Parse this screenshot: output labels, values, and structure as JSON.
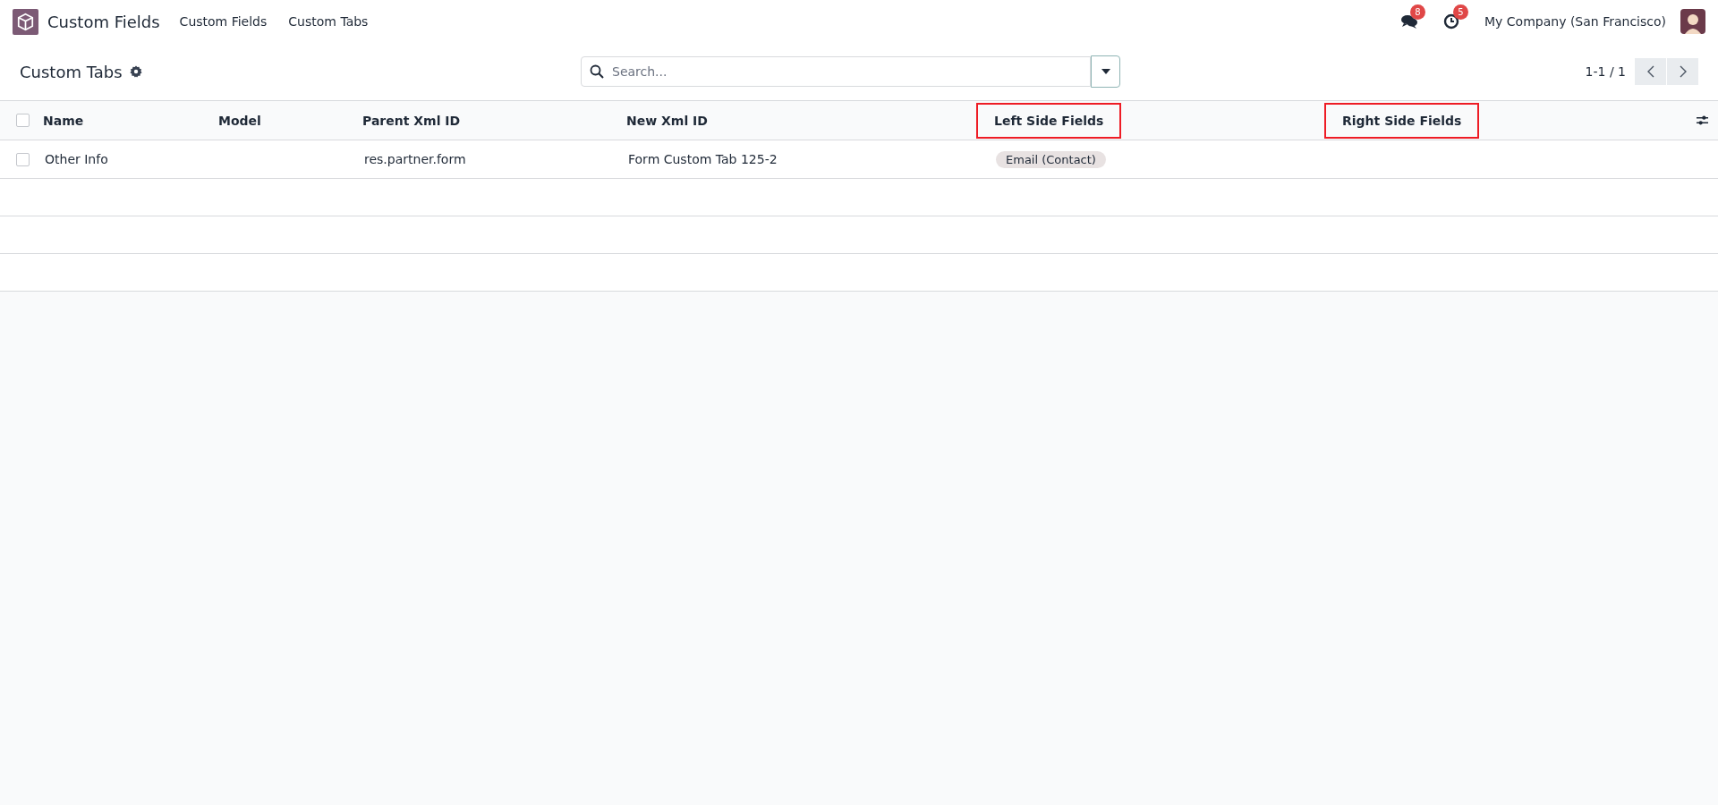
{
  "navbar": {
    "app_name": "Custom Fields",
    "menu": [
      "Custom Fields",
      "Custom Tabs"
    ],
    "messages_count": "8",
    "activities_count": "5",
    "company": "My Company (San Francisco)"
  },
  "control_panel": {
    "title": "Custom Tabs",
    "search": {
      "placeholder": "Search..."
    },
    "pager": "1-1 / 1"
  },
  "table": {
    "columns": [
      {
        "label": "Name",
        "highlighted": false
      },
      {
        "label": "Model",
        "highlighted": false
      },
      {
        "label": "Parent Xml ID",
        "highlighted": false
      },
      {
        "label": "New Xml ID",
        "highlighted": false
      },
      {
        "label": "Left Side Fields",
        "highlighted": true
      },
      {
        "label": "Right Side Fields",
        "highlighted": true
      }
    ],
    "rows": [
      {
        "checked": false,
        "name": "Other Info",
        "model": "",
        "parent_xml_id": "res.partner.form",
        "new_xml_id": "Form Custom Tab 125-2",
        "left_side_fields": [
          "Email (Contact)"
        ],
        "right_side_fields": []
      }
    ],
    "header_checked": false
  }
}
